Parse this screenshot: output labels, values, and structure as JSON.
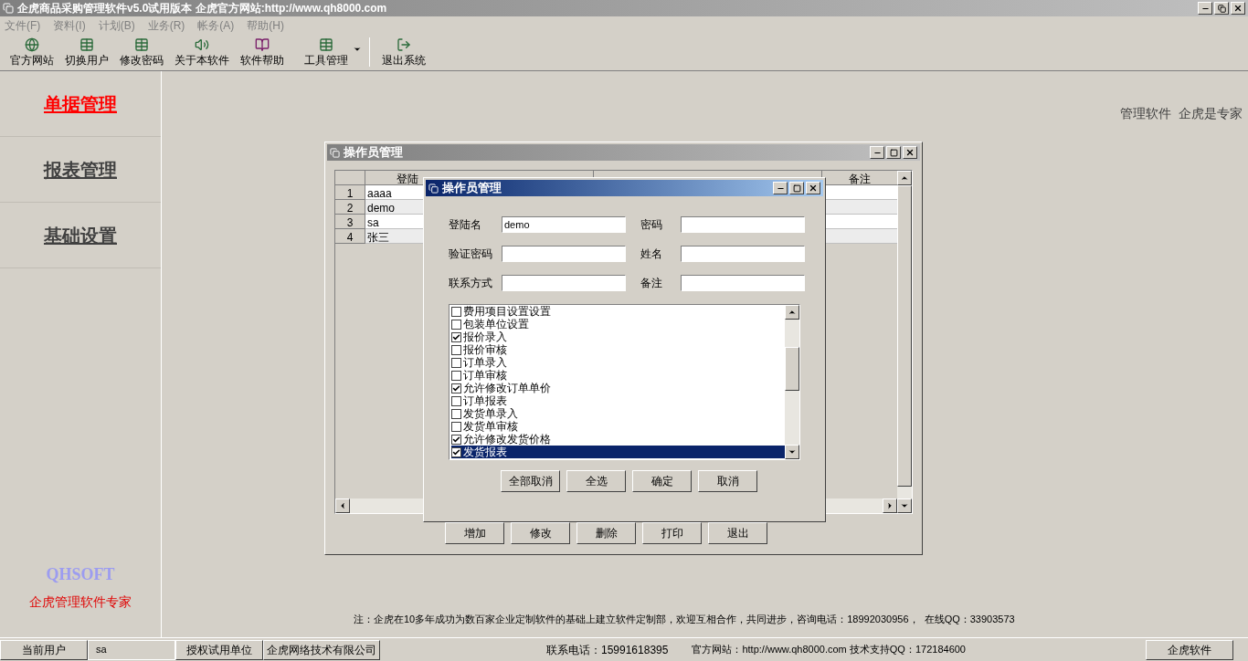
{
  "window": {
    "title": "企虎商品采购管理软件v5.0试用版本 企虎官方网站:http://www.qh8000.com"
  },
  "menu": [
    "文件(F)",
    "资料(I)",
    "计划(B)",
    "业务(R)",
    "帐务(A)",
    "帮助(H)"
  ],
  "toolbar": [
    {
      "label": "官方网站",
      "kind": "plain"
    },
    {
      "label": "切换用户",
      "kind": "plain"
    },
    {
      "label": "修改密码",
      "kind": "plain"
    },
    {
      "label": "关于本软件",
      "kind": "plain"
    },
    {
      "label": "软件帮助",
      "kind": "plain"
    },
    {
      "label": "工具管理",
      "kind": "dropdown"
    },
    {
      "label": "退出系统",
      "kind": "plain"
    }
  ],
  "sidebar": {
    "items": [
      {
        "label": "单据管理",
        "selected": true
      },
      {
        "label": "报表管理",
        "selected": false
      },
      {
        "label": "基础设置",
        "selected": false
      }
    ],
    "logo": "QHSOFT",
    "slogan": "企虎管理软件专家"
  },
  "banner": "管理软件  企虎是专家",
  "operator_window": {
    "title": "操作员管理",
    "columns": [
      "登陆",
      "备注"
    ],
    "rows": [
      {
        "number": "1",
        "login": "aaaa"
      },
      {
        "number": "2",
        "login": "demo"
      },
      {
        "number": "3",
        "login": "sa"
      },
      {
        "number": "4",
        "login": "张三"
      }
    ],
    "buttons": [
      "增加",
      "修改",
      "删除",
      "打印",
      "退出"
    ]
  },
  "operator_dialog": {
    "title": "操作员管理",
    "fields": [
      {
        "label": "登陆名",
        "value": "demo"
      },
      {
        "label": "密码"
      },
      {
        "label": "验证密码"
      },
      {
        "label": "姓名"
      },
      {
        "label": "联系方式"
      },
      {
        "label": "备注"
      }
    ],
    "permissions": [
      {
        "label": "费用项目设置设置",
        "checked": false,
        "selected": false
      },
      {
        "label": "包装单位设置",
        "checked": false,
        "selected": false
      },
      {
        "label": "报价录入",
        "checked": true,
        "selected": false
      },
      {
        "label": "报价审核",
        "checked": false,
        "selected": false
      },
      {
        "label": "订单录入",
        "checked": false,
        "selected": false
      },
      {
        "label": "订单审核",
        "checked": false,
        "selected": false
      },
      {
        "label": "允许修改订单单价",
        "checked": true,
        "selected": false
      },
      {
        "label": "订单报表",
        "checked": false,
        "selected": false
      },
      {
        "label": "发货单录入",
        "checked": false,
        "selected": false
      },
      {
        "label": "发货单审核",
        "checked": false,
        "selected": false
      },
      {
        "label": "允许修改发货价格",
        "checked": true,
        "selected": false
      },
      {
        "label": "发货报表",
        "checked": true,
        "selected": true
      }
    ],
    "buttons": [
      "全部取消",
      "全选",
      "确定",
      "取消"
    ]
  },
  "notice": "注：企虎在10多年成功为数百家企业定制软件的基础上建立软件定制部，欢迎互相合作，共同进步，咨询电话：18992030956，  在线QQ：33903573",
  "status_bar": {
    "user_label": "当前用户",
    "user": "sa",
    "license_label": "授权试用单位",
    "license": "企虎网络技术有限公司",
    "phone": "联系电话：15991618395",
    "website": "官方网站：http://www.qh8000.com 技术支持QQ：172184600",
    "button": "企虎软件"
  }
}
